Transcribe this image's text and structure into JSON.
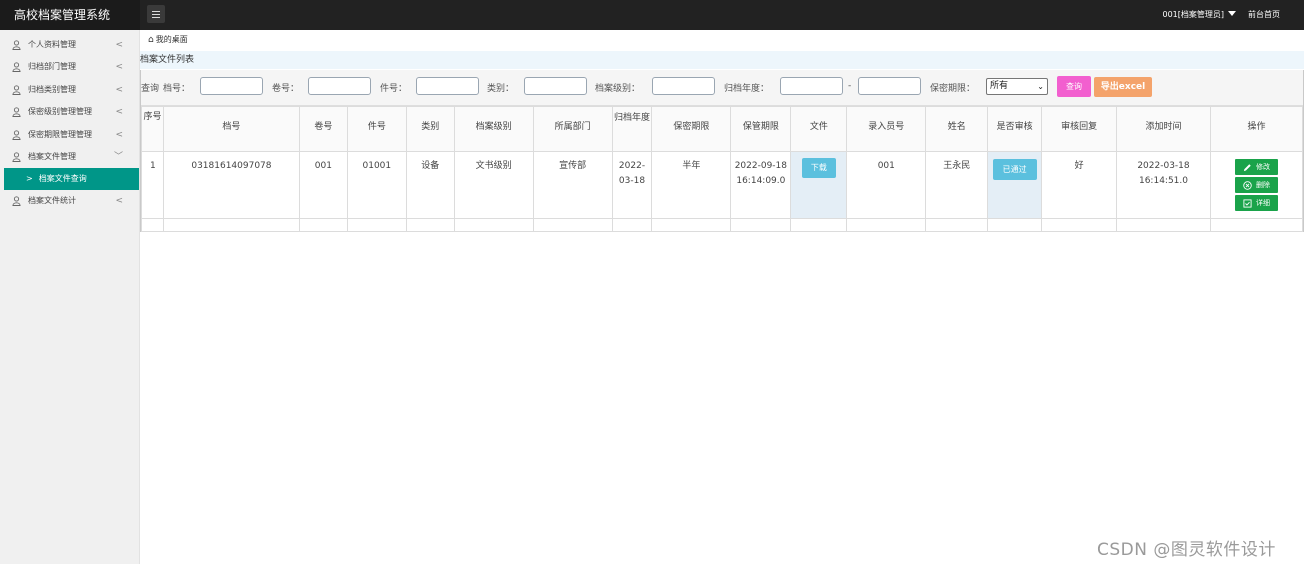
{
  "header": {
    "app_title": "高校档案管理系统",
    "user_label": "001[档案管理员]",
    "front_link": "前台首页"
  },
  "sidebar": {
    "items": [
      {
        "label": "个人资料管理",
        "chevron": "<"
      },
      {
        "label": "归档部门管理",
        "chevron": "<"
      },
      {
        "label": "归档类别管理",
        "chevron": "<"
      },
      {
        "label": "保密级别管理管理",
        "chevron": "<"
      },
      {
        "label": "保密期限管理管理",
        "chevron": "<"
      },
      {
        "label": "档案文件管理",
        "chevron": "﹀"
      },
      {
        "label": "档案文件统计",
        "chevron": "<"
      }
    ],
    "active_sub": {
      "arrow": ">",
      "label": "档案文件查询"
    }
  },
  "breadcrumb": {
    "home_icon": "⌂",
    "label": "我的桌面"
  },
  "list_title": "档案文件列表",
  "filter": {
    "query_prefix": "查询",
    "archive_no_label": "档号：",
    "volume_no_label": "卷号：",
    "item_no_label": "件号：",
    "category_label": "类别：",
    "level_label": "档案级别：",
    "year_label": "归档年度：",
    "dash": "-",
    "period_label": "保密期限：",
    "period_value": "所有",
    "query_button": "查询",
    "export_button": "导出excel"
  },
  "table": {
    "headers": {
      "seq": "序号",
      "archive_no": "档号",
      "volume_no": "卷号",
      "item_no": "件号",
      "category": "类别",
      "level": "档案级别",
      "department": "所属部门",
      "year": "归档年度",
      "secrecy_period": "保密期限",
      "keep_period": "保管期限",
      "file": "文件",
      "entry_no": "录入员号",
      "name": "姓名",
      "reviewed": "是否审核",
      "review_reply": "审核回复",
      "added_time": "添加时间",
      "actions": "操作"
    },
    "rows": [
      {
        "seq": "1",
        "archive_no": "03181614097078",
        "volume_no": "001",
        "item_no": "01001",
        "category": "设备",
        "level": "文书级别",
        "department": "宣传部",
        "year": "2022-03-18",
        "secrecy_period": "半年",
        "keep_period": "2022-09-18 16:14:09.0",
        "file_button": "下载",
        "entry_no": "001",
        "name": "王永民",
        "review_status": "已通过",
        "review_reply": "好",
        "added_time": "2022-03-18 16:14:51.0",
        "edit_button": "修改",
        "delete_button": "删除",
        "detail_button": "详细"
      }
    ]
  },
  "watermark": "CSDN @图灵软件设计",
  "colors": {
    "topbar": "#222222",
    "active_menu": "#009688",
    "query_button": "#f25fcf",
    "export_button": "#f4a36b",
    "info_button": "#5bc0de",
    "action_button": "#1aa34a"
  }
}
